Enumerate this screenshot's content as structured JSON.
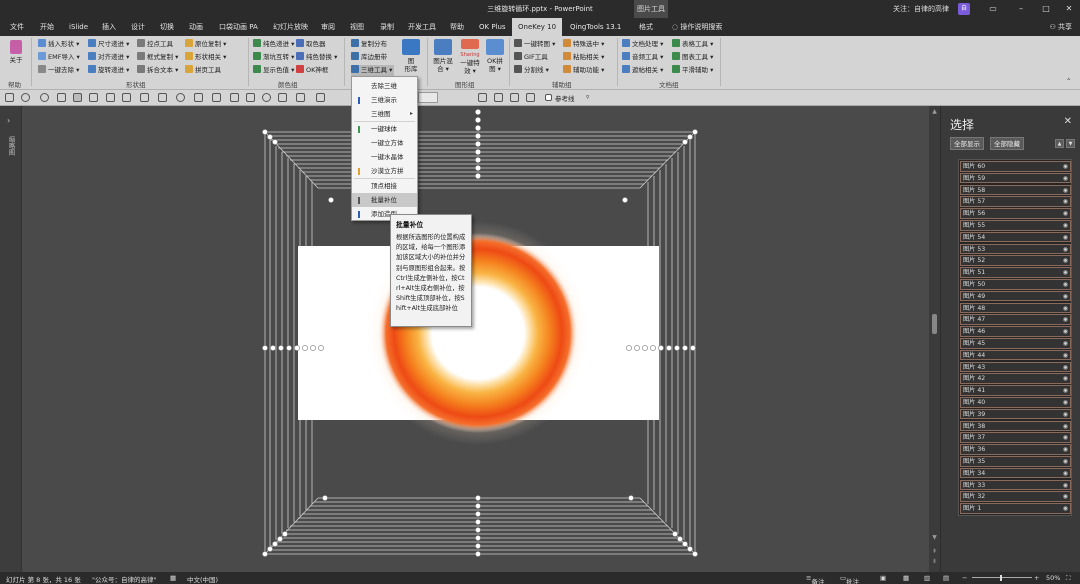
{
  "window": {
    "title": "三维旋转循环.pptx  -  PowerPoint",
    "context_tab": "图片工具",
    "follow_text": "关注：自律的高律",
    "user_badge": "自",
    "share": "共享"
  },
  "tabs": [
    "文件",
    "开始",
    "iSlide",
    "插入",
    "设计",
    "切换",
    "动画",
    "口袋动画 PA",
    "幻灯片放映",
    "审阅",
    "视图",
    "录制",
    "开发工具",
    "帮助",
    "OK Plus",
    "OneKey 10",
    "QingTools 13.1",
    "格式"
  ],
  "active_tab": "OneKey 10",
  "tell_me": "操作说明搜索",
  "ribbon": {
    "about": "关于",
    "help": "帮助",
    "shape_group": {
      "label": "形状组",
      "col1": [
        "插入形状 ▾",
        "EMF导入 ▾",
        "一键去除 ▾"
      ],
      "col2": [
        "尺寸递进 ▾",
        "对齐递进 ▾",
        "旋转递进 ▾"
      ],
      "col3": [
        "控点工具",
        "框式复制 ▾",
        "拆合文本 ▾"
      ],
      "col4": [
        "原位复制 ▾",
        "形状相关 ▾",
        "拼页工具"
      ]
    },
    "color_group": {
      "label": "颜色组",
      "col1": [
        "纯色递进 ▾",
        "渐坑互转 ▾",
        "显示色值 ▾"
      ],
      "col2": [
        "取色器",
        "纯色替换 ▾",
        "OK神框"
      ]
    },
    "three_d_group": {
      "items": [
        "复制分布",
        "库边册带",
        "三维工具 ▾"
      ],
      "big": "图\n形库"
    },
    "image_group": {
      "label": "图形组",
      "big1": "图片混\n合 ▾",
      "big2": "一键特\n效 ▾",
      "big3": "OK拼\n图 ▾",
      "glyph": "Sharing"
    },
    "aux_group": {
      "label": "辅助组",
      "col1": [
        "一键转图 ▾",
        "GIF工具",
        "分割线 ▾"
      ],
      "col2": [
        "特殊选中 ▾",
        "粘贴相关 ▾",
        "辅助功能 ▾"
      ]
    },
    "doc_group": {
      "label": "文档组",
      "col1": [
        "文档处理 ▾",
        "音频工具 ▾",
        "遮帖相关 ▾"
      ],
      "col2": [
        "表格工具 ▾",
        "图表工具 ▾",
        "平滑辅助 ▾"
      ]
    }
  },
  "quickbar": {
    "ref_line": "参考线"
  },
  "left_pane_label": "缩略图",
  "dropdown": {
    "items": [
      {
        "label": "去除三维",
        "mark": ""
      },
      {
        "label": "三维演示",
        "mark": "#2e5fb8"
      },
      {
        "label": "三维图",
        "mark": "",
        "sub": "▸"
      },
      {
        "label": "一键球体",
        "mark": "#3b9b55"
      },
      {
        "label": "一键立方体",
        "mark": ""
      },
      {
        "label": "一键水晶体",
        "mark": ""
      },
      {
        "label": "沙漠立方拼",
        "mark": "#e0a030"
      },
      {
        "label": "顶点相接",
        "mark": ""
      },
      {
        "label": "批量补位",
        "mark": "#555",
        "highlight": true
      },
      {
        "label": "添加造型",
        "mark": "#2e5fb8"
      }
    ]
  },
  "tooltip": {
    "title": "批量补位",
    "body": "根据所选图形的位置构成的区域，给每一个图形添加该区域大小的补位并分别与原图形组合起来。按Ctrl生成左侧补位，按Ctrl+Alt生成右侧补位，按Shift生成顶部补位，按Shift+Alt生成底部补位"
  },
  "vertical_text": "ONEKEY",
  "selection_pane": {
    "title": "选择",
    "show_all": "全部显示",
    "hide_all": "全部隐藏",
    "items": [
      "图片 60",
      "图片 59",
      "图片 58",
      "图片 57",
      "图片 56",
      "图片 55",
      "图片 54",
      "图片 53",
      "图片 52",
      "图片 51",
      "图片 50",
      "图片 49",
      "图片 48",
      "图片 47",
      "图片 46",
      "图片 45",
      "图片 44",
      "图片 43",
      "图片 42",
      "图片 41",
      "图片 40",
      "图片 39",
      "图片 38",
      "图片 37",
      "图片 36",
      "图片 35",
      "图片 34",
      "图片 33",
      "图片 32",
      "图片 1"
    ]
  },
  "statusbar": {
    "slide_info": "幻灯片 第 8 张，共 16 张",
    "wechat": "\"公众号：自律的高律\"",
    "lang": "中文(中国)",
    "notes": "备注",
    "comments": "批注",
    "zoom": "50%"
  }
}
